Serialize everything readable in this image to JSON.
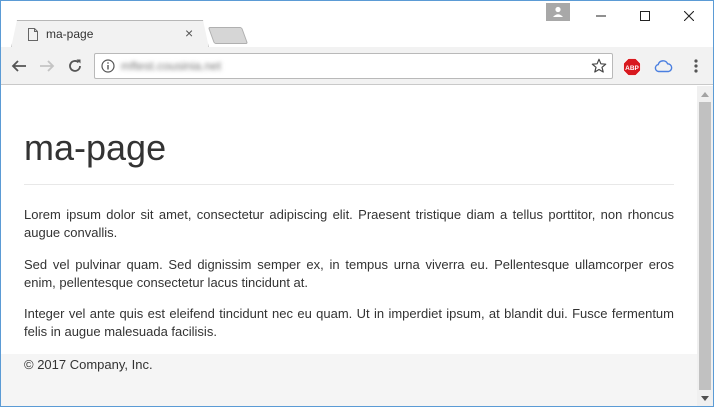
{
  "browser": {
    "tab_title": "ma-page",
    "tab_close": "×",
    "url": "mftest.cousinia.net",
    "icons": {
      "page": "page-icon",
      "back": "arrow-left-icon",
      "forward": "arrow-right-icon",
      "reload": "reload-icon",
      "info": "info-icon",
      "star": "star-icon",
      "abp": "adblock-plus-icon",
      "cloud": "cloud-icon",
      "menu": "kebab-menu-icon"
    },
    "abp_label": "ABP"
  },
  "page": {
    "title": "ma-page",
    "paragraphs": [
      "Lorem ipsum dolor sit amet, consectetur adipiscing elit. Praesent tristique diam a tellus porttitor, non rhoncus augue convallis.",
      "Sed vel pulvinar quam. Sed dignissim semper ex, in tempus urna viverra eu. Pellentesque ullamcorper eros enim, pellentesque consectetur lacus tincidunt at.",
      "Integer vel ante quis est eleifend tincidunt nec eu quam. Ut in imperdiet ipsum, at blandit dui. Fusce fermentum felis in augue malesuada facilisis."
    ],
    "footer": "© 2017 Company, Inc."
  },
  "colors": {
    "window_border": "#5b9bd5",
    "abp_red": "#d8191f",
    "cloud_blue": "#4a7fe0"
  }
}
